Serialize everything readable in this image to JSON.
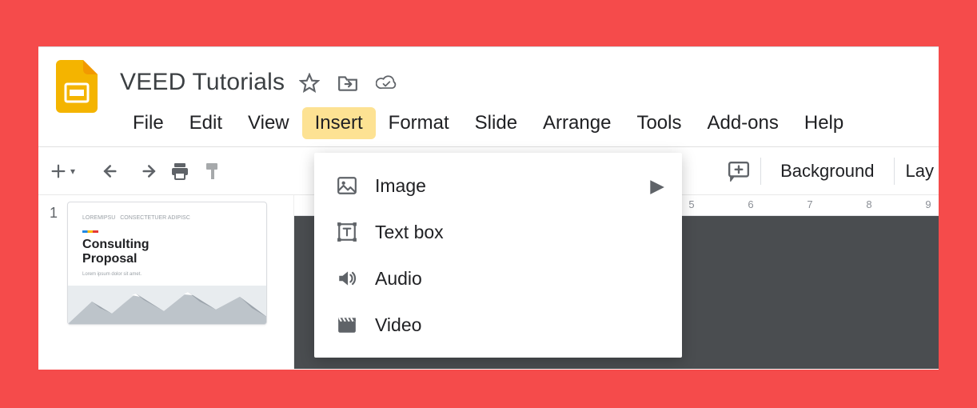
{
  "document": {
    "title": "VEED Tutorials"
  },
  "menubar": {
    "items": [
      "File",
      "Edit",
      "View",
      "Insert",
      "Format",
      "Slide",
      "Arrange",
      "Tools",
      "Add-ons",
      "Help"
    ],
    "active_index": 3
  },
  "toolbar": {
    "background_label": "Background",
    "layout_label": "Lay"
  },
  "ruler": {
    "ticks": [
      "5",
      "6",
      "7",
      "8",
      "9"
    ]
  },
  "slide_panel": {
    "number": "1",
    "thumb": {
      "crumb1": "LOREMIPSU",
      "crumb2": "CONSECTETUER ADIPISC",
      "title1": "Consulting",
      "title2": "Proposal",
      "lorem": "Lorem ipsum dolor sit amet."
    }
  },
  "insert_menu": {
    "items": [
      {
        "label": "Image",
        "has_submenu": true,
        "icon": "image"
      },
      {
        "label": "Text box",
        "has_submenu": false,
        "icon": "textbox"
      },
      {
        "label": "Audio",
        "has_submenu": false,
        "icon": "audio"
      },
      {
        "label": "Video",
        "has_submenu": false,
        "icon": "video"
      }
    ]
  }
}
